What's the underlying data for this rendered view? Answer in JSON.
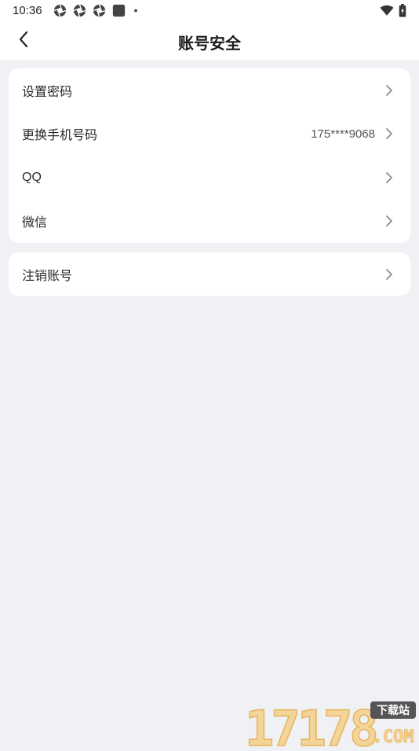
{
  "status_bar": {
    "time": "10:36",
    "left_icons": [
      "aperture-icon",
      "aperture-icon",
      "aperture-icon",
      "square-notification-icon",
      "dot-icon"
    ],
    "right_icons": [
      "wifi-icon",
      "battery-charging-icon"
    ]
  },
  "header": {
    "back_icon": "chevron-left-icon",
    "title": "账号安全"
  },
  "settings": {
    "items": [
      {
        "label": "设置密码",
        "value": ""
      },
      {
        "label": "更换手机号码",
        "value": "175****9068"
      },
      {
        "label": "QQ",
        "value": ""
      },
      {
        "label": "微信",
        "value": ""
      }
    ]
  },
  "account": {
    "items": [
      {
        "label": "注销账号"
      }
    ]
  },
  "watermark": {
    "logo_text": "17178",
    "badge_text": "下载站",
    "domain_text": ".COM"
  }
}
